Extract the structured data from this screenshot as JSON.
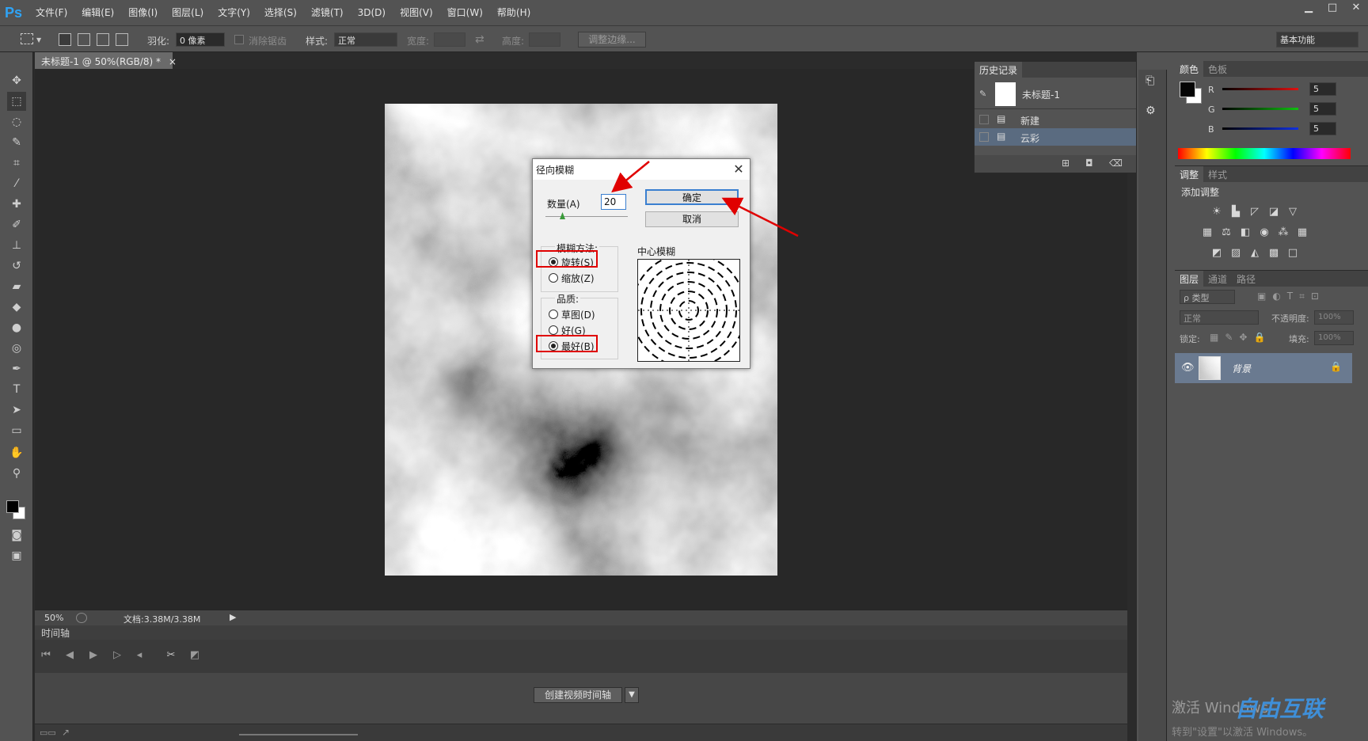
{
  "app": {
    "logo": "Ps"
  },
  "menu": [
    "文件(F)",
    "编辑(E)",
    "图像(I)",
    "图层(L)",
    "文字(Y)",
    "选择(S)",
    "滤镜(T)",
    "3D(D)",
    "视图(V)",
    "窗口(W)",
    "帮助(H)"
  ],
  "window_controls": [
    "▁",
    "□",
    "✕"
  ],
  "options": {
    "feather_label": "羽化:",
    "feather_value": "0 像素",
    "antialias_label": "消除锯齿",
    "style_label": "样式:",
    "style_value": "正常",
    "width_label": "宽度:",
    "height_label": "高度:",
    "refine_edge": "调整边缘...",
    "workspace": "基本功能"
  },
  "document": {
    "tab_title": "未标题-1 @ 50%(RGB/8) *",
    "tab_close": "×"
  },
  "status": {
    "zoom": "50%",
    "doc_info": "文档:3.38M/3.38M"
  },
  "timeline": {
    "title": "时间轴",
    "create_button": "创建视频时间轴"
  },
  "history": {
    "tabs": [
      "历史记录"
    ],
    "snapshot": "未标题-1",
    "items": [
      {
        "label": "新建",
        "active": false
      },
      {
        "label": "云彩",
        "active": true
      }
    ]
  },
  "color_panel": {
    "tabs": [
      "颜色",
      "色板"
    ],
    "channels": [
      {
        "name": "R",
        "value": "5",
        "color": "#e01010"
      },
      {
        "name": "G",
        "value": "5",
        "color": "#10c010"
      },
      {
        "name": "B",
        "value": "5",
        "color": "#1030e0"
      }
    ]
  },
  "adjust_panel": {
    "tabs": [
      "调整",
      "样式"
    ],
    "title": "添加调整"
  },
  "layers_panel": {
    "tabs": [
      "图层",
      "通道",
      "路径"
    ],
    "filter_kind": "ρ 类型",
    "blend_mode": "正常",
    "opacity_label": "不透明度:",
    "opacity_value": "100%",
    "lock_label": "锁定:",
    "fill_label": "填充:",
    "fill_value": "100%",
    "layer_name": "背景"
  },
  "dialog": {
    "title": "径向模糊",
    "amount_label": "数量(A)",
    "amount_value": "20",
    "ok": "确定",
    "cancel": "取消",
    "method_label": "模糊方法:",
    "method_spin": "旋转(S)",
    "method_zoom": "缩放(Z)",
    "quality_label": "品质:",
    "quality_draft": "草图(D)",
    "quality_good": "好(G)",
    "quality_best": "最好(B)",
    "center_label": "中心模糊",
    "method_selected": "旋转(S)",
    "quality_selected": "最好(B)"
  },
  "watermark": {
    "line1": "激活 Windows",
    "line2": "转到\"设置\"以激活 Windows。",
    "brand": "自由互联"
  }
}
